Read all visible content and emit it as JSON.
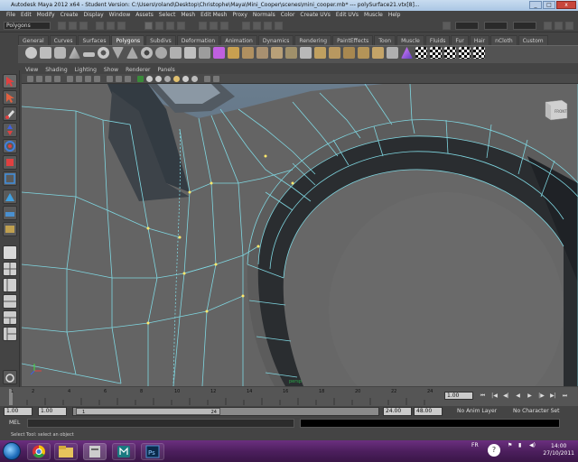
{
  "window": {
    "title": "Autodesk Maya 2012 x64 - Student Version: C:\\Users\\roland\\Desktop\\Christophe\\Maya\\Mini_Cooper\\scenes\\mini_cooper.mb* --- polySurface21.vtx[8]...",
    "minimize": "_",
    "maximize": "□",
    "close": "x"
  },
  "menubar": [
    "File",
    "Edit",
    "Modify",
    "Create",
    "Display",
    "Window",
    "Assets",
    "Select",
    "Mesh",
    "Edit Mesh",
    "Proxy",
    "Normals",
    "Color",
    "Create UVs",
    "Edit UVs",
    "Muscle",
    "Help"
  ],
  "statusline": {
    "mode": "Polygons"
  },
  "shelf_tabs": [
    "General",
    "Curves",
    "Surfaces",
    "Polygons",
    "Subdivs",
    "Deformation",
    "Animation",
    "Dynamics",
    "Rendering",
    "PaintEffects",
    "Toon",
    "Muscle",
    "Fluids",
    "Fur",
    "Hair",
    "nCloth",
    "Custom"
  ],
  "shelf_active": "Polygons",
  "panel_menu": [
    "View",
    "Shading",
    "Lighting",
    "Show",
    "Renderer",
    "Panels"
  ],
  "viewport": {
    "viewcube_label": "FRONT",
    "camera_label": "persp"
  },
  "timeline": {
    "ticks": [
      "1",
      "2",
      "4",
      "6",
      "8",
      "10",
      "12",
      "14",
      "16",
      "18",
      "20",
      "22",
      "24"
    ],
    "current_frame": "1.00"
  },
  "range": {
    "start_time": "1.00",
    "start_range": "1.00",
    "slider_start": "1",
    "slider_end": "24",
    "end_range": "24.00",
    "end_time": "48.00",
    "anim_layer": "No Anim Layer",
    "character_set": "No Character Set"
  },
  "command_line": {
    "label": "MEL"
  },
  "help_line": "Select Tool: select an object",
  "taskbar": {
    "language": "FR",
    "time": "14:00",
    "date": "27/10/2011",
    "ps_label": "Ps"
  },
  "colors": {
    "wire": "#7fd6e0",
    "shell": "#646464",
    "bg_top": "#6a7d8e",
    "taskbar": "#5a2770"
  }
}
